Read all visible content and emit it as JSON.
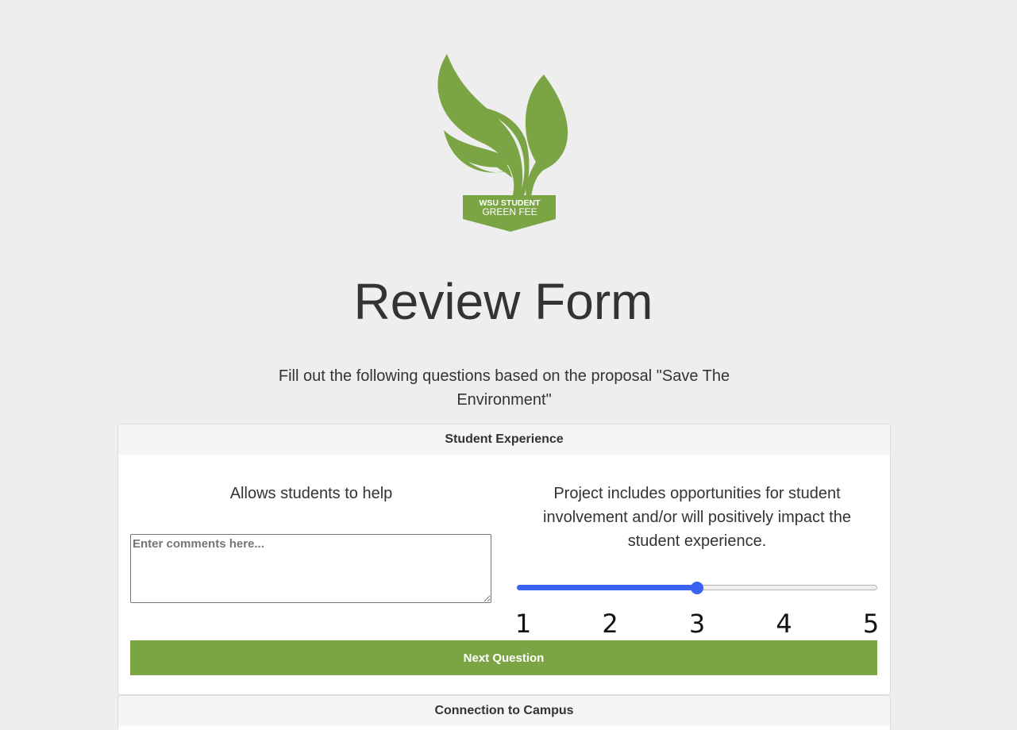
{
  "logo": {
    "text_line1": "WSU STUDENT",
    "text_line2": "GREEN FEE",
    "color": "#7ba545"
  },
  "title": "Review Form",
  "intro": "Fill out the following questions based on the proposal \"Save The Environment\"",
  "sections": [
    {
      "heading": "Student Experience",
      "short_question": "Allows students to help",
      "comments_placeholder": "Enter comments here...",
      "comments_value": "",
      "long_question": "Project includes opportunities for student involvement and/or will positively impact the student experience.",
      "rating": {
        "min": 1,
        "max": 5,
        "value": 3,
        "labels": [
          "1",
          "2",
          "3",
          "4",
          "5"
        ]
      },
      "next_label": "Next Question"
    },
    {
      "heading": "Connection to Campus"
    }
  ],
  "colors": {
    "accent": "#7ba545",
    "slider": "#3b63f2",
    "background": "#eeeeee"
  }
}
